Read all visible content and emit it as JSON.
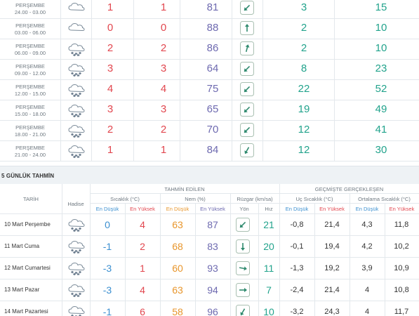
{
  "hourly": [
    {
      "day": "PERŞEMBE",
      "time": "24.00 - 03.00",
      "icon": "cloud-icon",
      "temp": "1",
      "feels": "1",
      "humidity": "81",
      "wind_dir": 225,
      "wind": "3",
      "gust": "15"
    },
    {
      "day": "PERŞEMBE",
      "time": "03.00 - 06.00",
      "icon": "cloud-icon",
      "temp": "0",
      "feels": "0",
      "humidity": "88",
      "wind_dir": 0,
      "wind": "2",
      "gust": "10"
    },
    {
      "day": "PERŞEMBE",
      "time": "06.00 - 09.00",
      "icon": "snow-cloud-icon",
      "temp": "2",
      "feels": "2",
      "humidity": "86",
      "wind_dir": 15,
      "wind": "2",
      "gust": "10"
    },
    {
      "day": "PERŞEMBE",
      "time": "09.00 - 12.00",
      "icon": "snow-cloud-icon",
      "temp": "3",
      "feels": "3",
      "humidity": "64",
      "wind_dir": 225,
      "wind": "8",
      "gust": "23"
    },
    {
      "day": "PERŞEMBE",
      "time": "12.00 - 15.00",
      "icon": "snow-cloud-icon",
      "temp": "4",
      "feels": "4",
      "humidity": "75",
      "wind_dir": 225,
      "wind": "22",
      "gust": "52"
    },
    {
      "day": "PERŞEMBE",
      "time": "15.00 - 18.00",
      "icon": "snow-cloud-icon",
      "temp": "3",
      "feels": "3",
      "humidity": "65",
      "wind_dir": 225,
      "wind": "19",
      "gust": "49"
    },
    {
      "day": "PERŞEMBE",
      "time": "18.00 - 21.00",
      "icon": "snow-cloud-icon",
      "temp": "2",
      "feels": "2",
      "humidity": "70",
      "wind_dir": 225,
      "wind": "12",
      "gust": "41"
    },
    {
      "day": "PERŞEMBE",
      "time": "21.00 - 24.00",
      "icon": "snow-cloud-icon",
      "temp": "1",
      "feels": "1",
      "humidity": "84",
      "wind_dir": 210,
      "wind": "12",
      "gust": "30"
    }
  ],
  "five_day": {
    "title": "5 GÜNLÜK TAHMİN",
    "col_date": "TARİH",
    "col_event": "Hadise",
    "group_forecast": "TAHMİN EDİLEN",
    "group_past": "GEÇMİŞTE GERÇEKLEŞEN",
    "sub_temp": "Sıcaklık (°C)",
    "sub_hum": "Nem (%)",
    "sub_wind": "Rüzgar (km/sa)",
    "sub_extreme": "Uç Sıcaklık (°C)",
    "sub_avg": "Ortalama Sıcaklık (°C)",
    "low": "En Düşük",
    "high": "En Yüksek",
    "dir": "Yön",
    "speed": "Hız",
    "days": [
      {
        "name": "10 Mart Perşembe",
        "icon": "snow-cloud-icon",
        "tlow": "0",
        "thigh": "4",
        "hlow": "63",
        "hhigh": "87",
        "wind_dir": 225,
        "wspeed": "21",
        "elow": "-0,8",
        "ehigh": "21,4",
        "alow": "4,3",
        "ahigh": "11,8"
      },
      {
        "name": "11 Mart Cuma",
        "icon": "snow-cloud-icon",
        "tlow": "-1",
        "thigh": "2",
        "hlow": "68",
        "hhigh": "83",
        "wind_dir": 180,
        "wspeed": "20",
        "elow": "-0,1",
        "ehigh": "19,4",
        "alow": "4,2",
        "ahigh": "10,2"
      },
      {
        "name": "12 Mart Cumartesi",
        "icon": "snow-cloud-icon",
        "tlow": "-3",
        "thigh": "1",
        "hlow": "60",
        "hhigh": "93",
        "wind_dir": 100,
        "wspeed": "11",
        "elow": "-1,3",
        "ehigh": "19,2",
        "alow": "3,9",
        "ahigh": "10,9"
      },
      {
        "name": "13 Mart Pazar",
        "icon": "snow-cloud-icon",
        "tlow": "-3",
        "thigh": "4",
        "hlow": "63",
        "hhigh": "94",
        "wind_dir": 90,
        "wspeed": "7",
        "elow": "-2,4",
        "ehigh": "21,4",
        "alow": "4",
        "ahigh": "10,8"
      },
      {
        "name": "14 Mart Pazartesi",
        "icon": "snow-cloud-icon",
        "tlow": "-1",
        "thigh": "6",
        "hlow": "58",
        "hhigh": "96",
        "wind_dir": 210,
        "wspeed": "10",
        "elow": "-3,2",
        "ehigh": "24,3",
        "alow": "4",
        "ahigh": "11,7"
      }
    ]
  }
}
